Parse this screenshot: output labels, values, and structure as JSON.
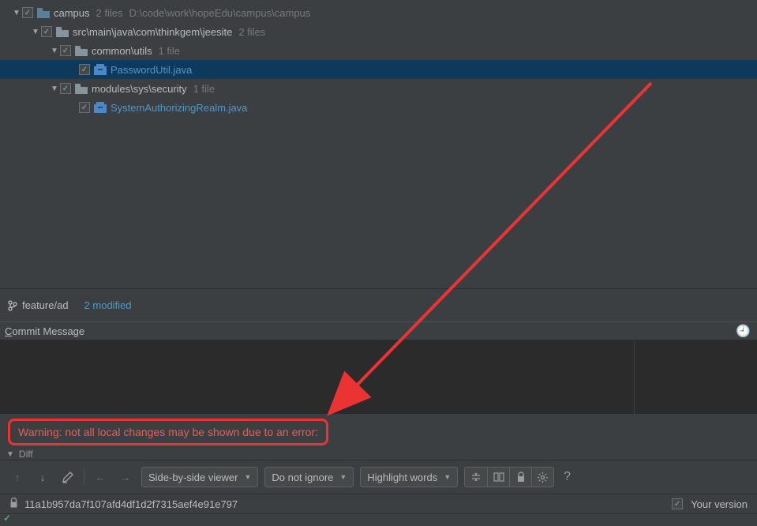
{
  "tree": {
    "root": {
      "name": "campus",
      "meta_count": "2 files",
      "meta_path": "D:\\code\\work\\hopeEdu\\campus\\campus"
    },
    "pkg": {
      "name": "src\\main\\java\\com\\thinkgem\\jeesite",
      "meta": "2 files"
    },
    "common": {
      "name": "common\\utils",
      "meta": "1 file"
    },
    "pwfile": {
      "name": "PasswordUtil.java"
    },
    "modules": {
      "name": "modules\\sys\\security",
      "meta": "1 file"
    },
    "sysfile": {
      "name": "SystemAuthorizingRealm.java"
    }
  },
  "status": {
    "branch": "feature/ad",
    "modified": "2 modified"
  },
  "commit": {
    "label_prefix": "C",
    "label_rest": "ommit Message"
  },
  "warning": {
    "text": "Warning: not all local changes may be shown due to an error:"
  },
  "diff": {
    "label": "Diff"
  },
  "toolbar": {
    "viewer": "Side-by-side viewer",
    "ignore": "Do not ignore",
    "highlight": "Highlight words"
  },
  "hash": {
    "value": "11a1b957da7f107afd4df1d2f7315aef4e91e797",
    "your_version": "Your version"
  },
  "checkmark": "✓"
}
